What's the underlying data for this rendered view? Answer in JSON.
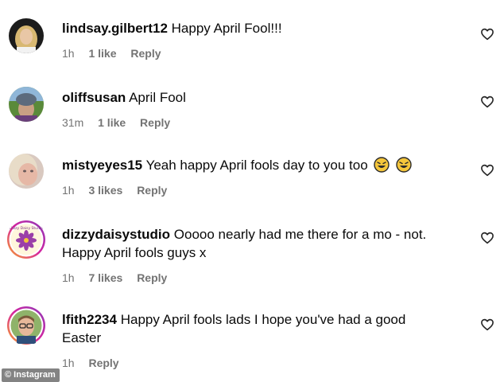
{
  "comments": [
    {
      "username": "lindsay.gilbert12",
      "text": "Happy April Fool!!!",
      "time": "1h",
      "likes": "1 like",
      "reply": "Reply",
      "avatar": "avatar-woman-blonde"
    },
    {
      "username": "oliffsusan",
      "text": "April Fool",
      "time": "31m",
      "likes": "1 like",
      "reply": "Reply",
      "avatar": "avatar-woman-hat"
    },
    {
      "username": "mistyeyes15",
      "text": "Yeah happy April fools day to you too",
      "time": "1h",
      "likes": "3 likes",
      "reply": "Reply",
      "avatar": "avatar-woman-selfie"
    },
    {
      "username": "dizzydaisystudio",
      "text": "Ooooo nearly had me there for a mo - not.",
      "text2": "Happy April fools guys x",
      "time": "1h",
      "likes": "7 likes",
      "reply": "Reply",
      "avatar": "avatar-daisy-logo",
      "avatar_text": "Dizzy Daisy Studio"
    },
    {
      "username": "lfith2234",
      "text": "Happy April fools lads I hope you've had a good",
      "text2": "Easter",
      "time": "1h",
      "reply": "Reply",
      "avatar": "avatar-man-glasses"
    }
  ],
  "watermark": "© Instagram",
  "colors": {
    "text": "#0a0a0a",
    "meta": "#737373",
    "story_ring": "#d6249f"
  }
}
